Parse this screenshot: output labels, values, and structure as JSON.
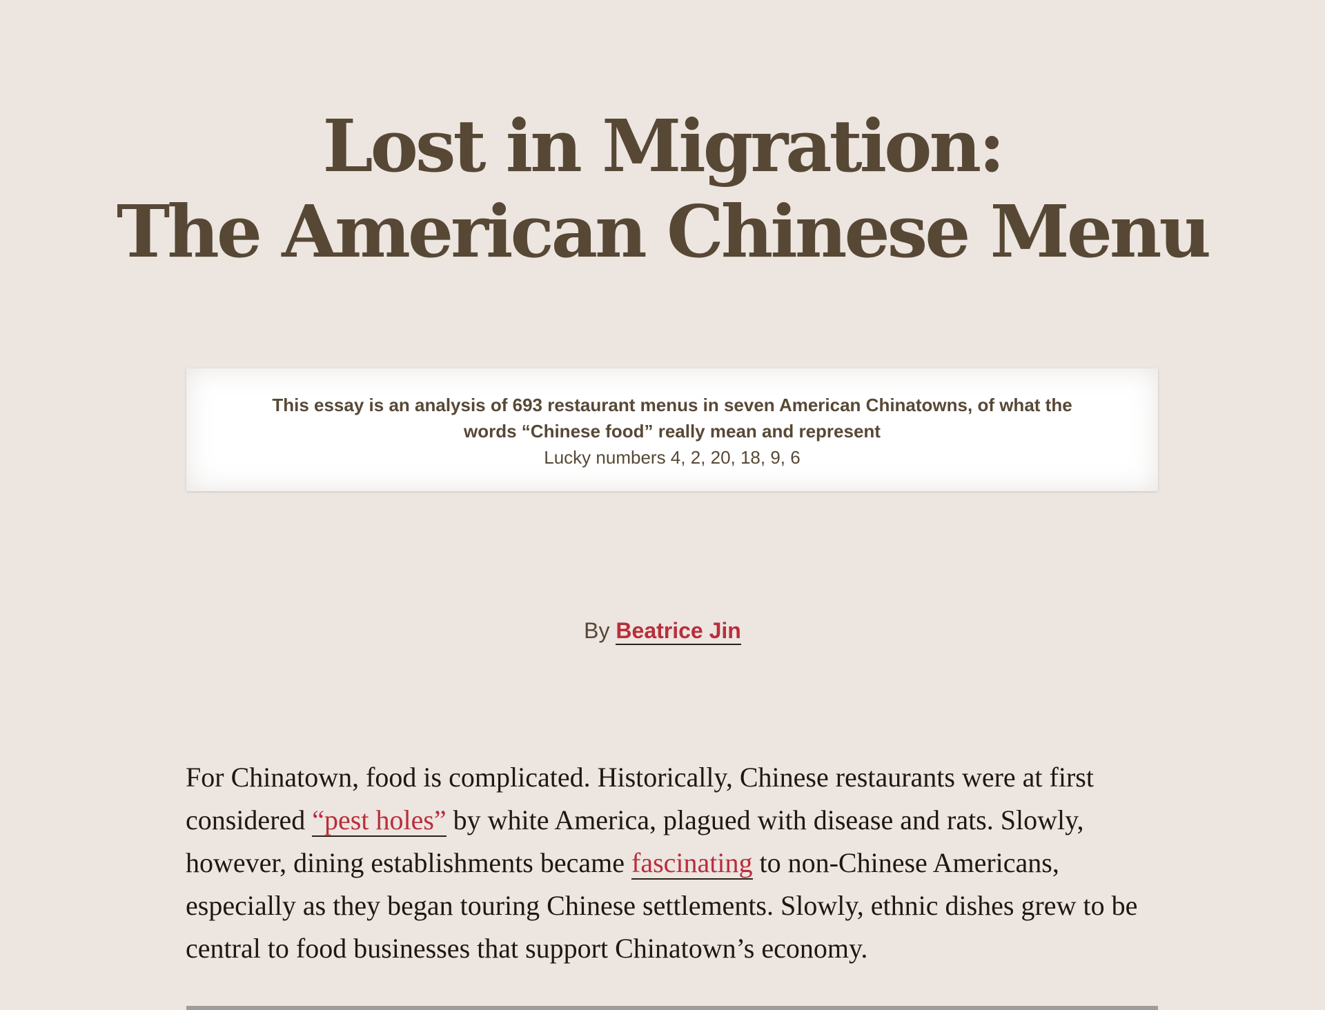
{
  "article": {
    "title_line1": "Lost in Migration:",
    "title_line2": "The American Chinese Menu",
    "summary": "This essay is an analysis of 693 restaurant menus in seven American Chinatowns, of what the words “Chinese food” really mean and represent",
    "lucky_numbers": "Lucky numbers 4, 2, 20, 18, 9, 6",
    "byline_prefix": "By ",
    "author": "Beatrice Jin",
    "paragraph1": {
      "part1": "For Chinatown, food is complicated. Historically, Chinese restaurants were at first considered ",
      "link1": "“pest holes”",
      "part2": " by white America, plagued with disease and rats. Slowly, however, dining establishments became ",
      "link2": "fascinating",
      "part3": " to non-Chinese Americans, especially as they began touring Chinese settlements. Slowly, ethnic dishes grew to be central to food businesses that support Chinatown’s economy."
    }
  },
  "colors": {
    "background": "#ede5df",
    "title": "#574836",
    "link": "#b82e3c",
    "body_text": "#1f1712"
  }
}
